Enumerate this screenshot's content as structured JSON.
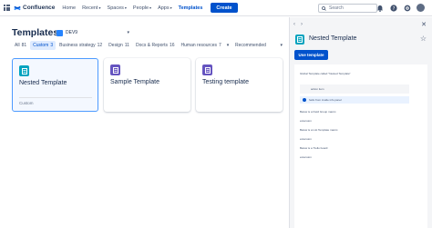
{
  "nav": {
    "brand": "Confluence",
    "items": [
      {
        "label": "Home",
        "chevron": false,
        "active": false
      },
      {
        "label": "Recent",
        "chevron": true,
        "active": false
      },
      {
        "label": "Spaces",
        "chevron": true,
        "active": false
      },
      {
        "label": "People",
        "chevron": true,
        "active": false
      },
      {
        "label": "Apps",
        "chevron": true,
        "active": false
      },
      {
        "label": "Templates",
        "chevron": false,
        "active": true
      }
    ],
    "create_label": "Create",
    "search_placeholder": "Search"
  },
  "main": {
    "title": "Templates",
    "space": "DEV9",
    "filters": [
      {
        "label": "All",
        "count": "81"
      },
      {
        "label": "Custom",
        "count": "3"
      },
      {
        "label": "Business strategy",
        "count": "12"
      },
      {
        "label": "Design",
        "count": "11"
      },
      {
        "label": "Docs & Reports",
        "count": "16"
      },
      {
        "label": "Human resources",
        "count": "7"
      }
    ],
    "selected_filter": "Custom",
    "sort_label": "Recommended",
    "cards": [
      {
        "title": "Nested Template",
        "subtitle": "Custom",
        "icon": "page-icon",
        "icon_color": "#00a3bf",
        "selected": true
      },
      {
        "title": "Sample Template",
        "subtitle": "",
        "icon": "page-icon",
        "icon_color": "#6554c0",
        "selected": false
      },
      {
        "title": "Testing template",
        "subtitle": "",
        "icon": "page-icon",
        "icon_color": "#6554c0",
        "selected": false
      }
    ]
  },
  "panel": {
    "title": "Nested Template",
    "use_label": "Use template",
    "preview": {
      "line1": "Global Template called \"Nested Template\"",
      "action_item": "action item",
      "panel_text": "hello from inside info panel",
      "line_fields": "Below is a Field Group macro:",
      "ext1": "extension",
      "line_list": "Below is a List Template macro:",
      "ext2": "extension",
      "line_trello": "Below is a Trello board:",
      "ext3": "extension"
    }
  },
  "colors": {
    "accent": "#0052cc",
    "selected_border": "#4c9aff",
    "teal": "#00a3bf",
    "purple": "#6554c0"
  }
}
